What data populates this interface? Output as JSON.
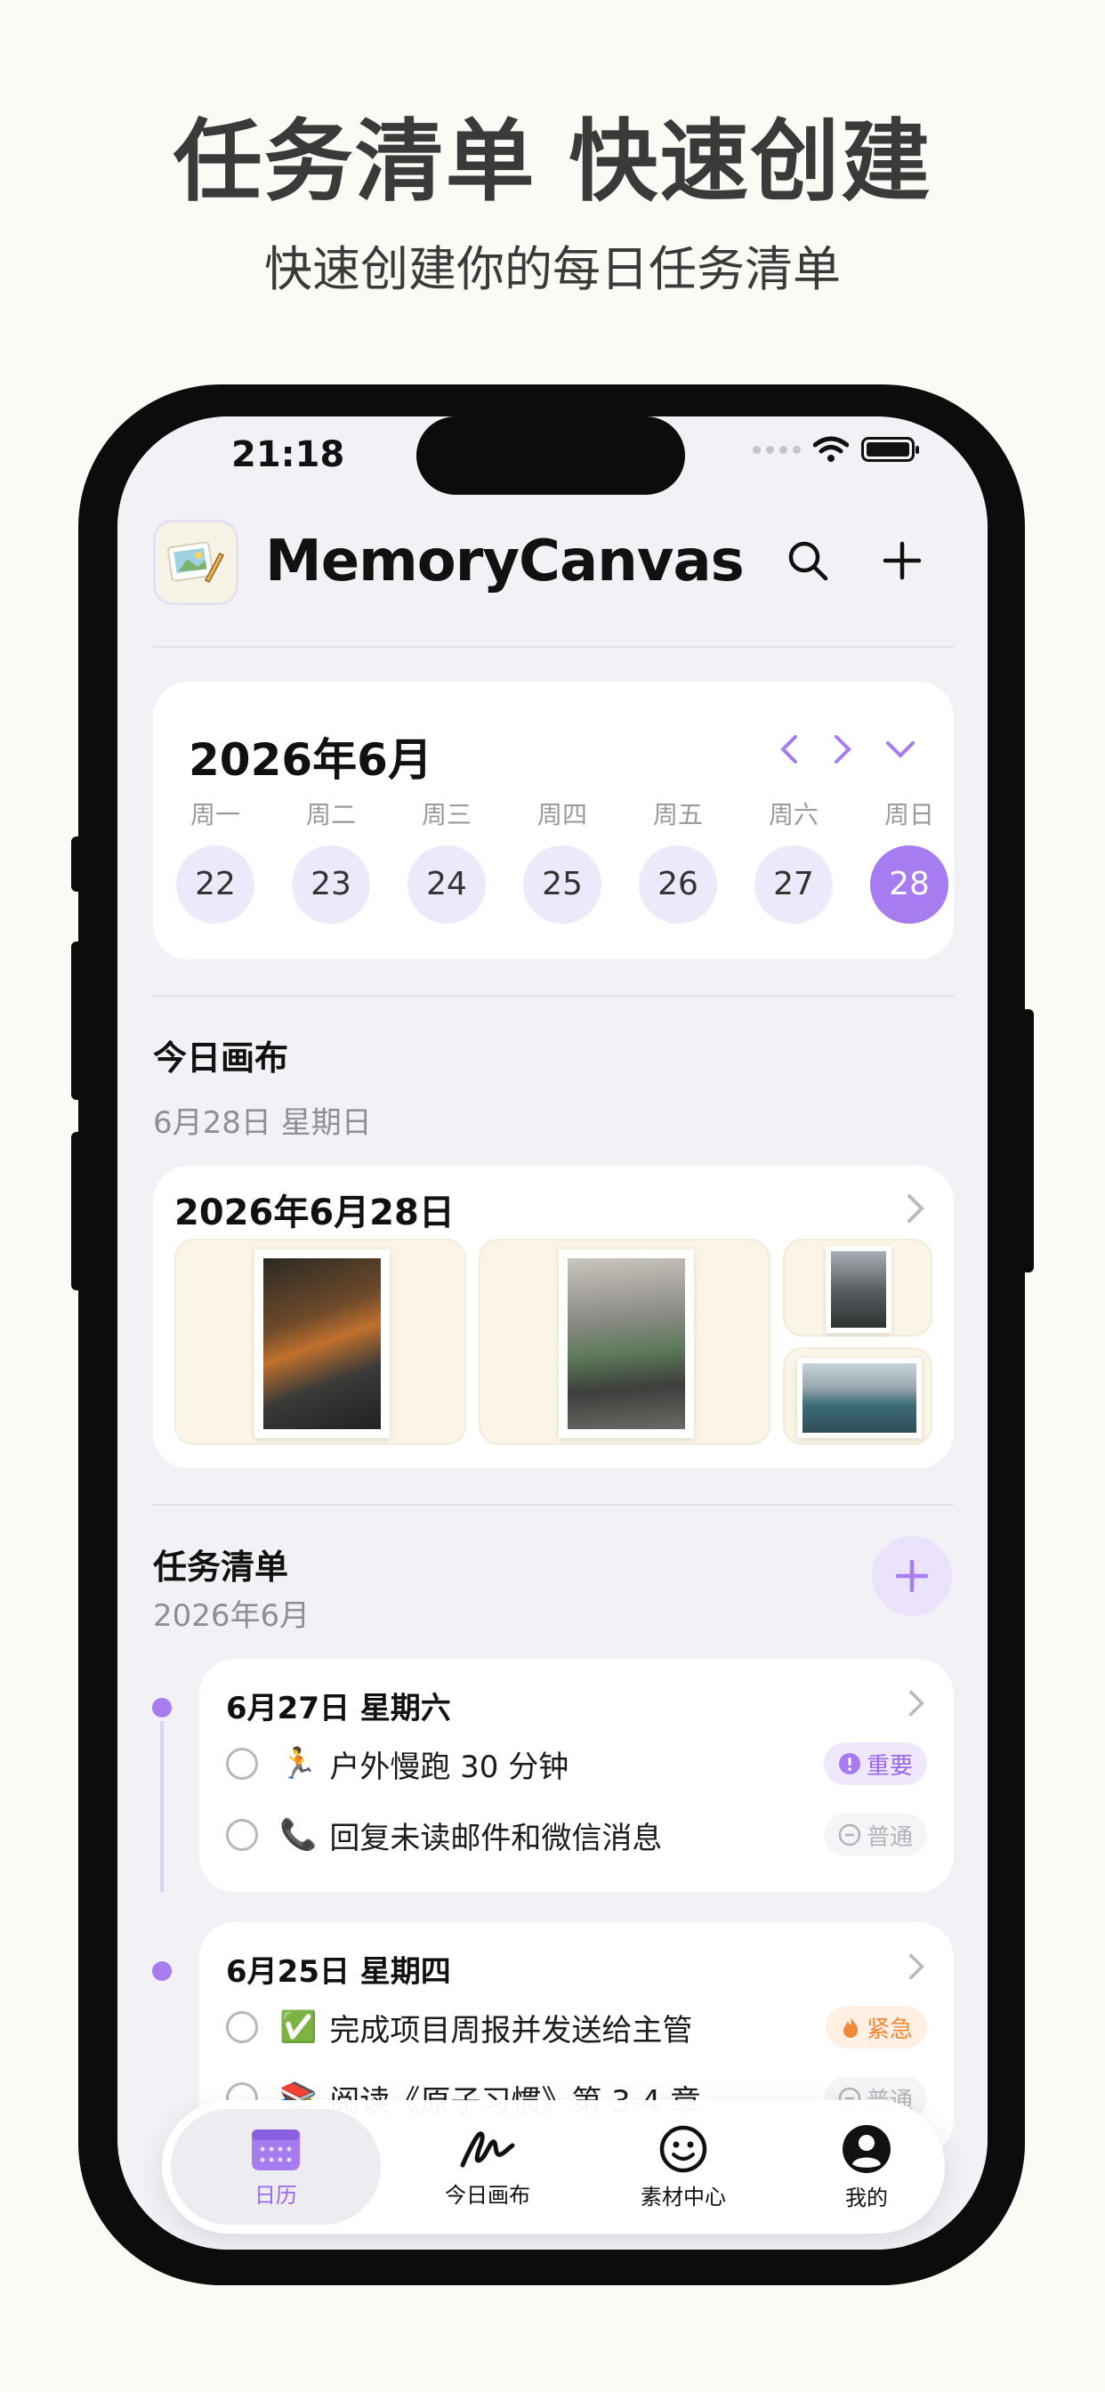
{
  "promo": {
    "title": "任务清单 快速创建",
    "subtitle": "快速创建你的每日任务清单"
  },
  "status_bar": {
    "time": "21:18"
  },
  "header": {
    "app_name": "MemoryCanvas",
    "search_icon": "search-icon",
    "add_icon": "plus-icon"
  },
  "calendar": {
    "month_label": "2026年6月",
    "days": [
      {
        "weekday": "周一",
        "date": "22"
      },
      {
        "weekday": "周二",
        "date": "23"
      },
      {
        "weekday": "周三",
        "date": "24"
      },
      {
        "weekday": "周四",
        "date": "25"
      },
      {
        "weekday": "周五",
        "date": "26"
      },
      {
        "weekday": "周六",
        "date": "27"
      },
      {
        "weekday": "周日",
        "date": "28"
      }
    ],
    "selected_date": "28",
    "accent_color": "#a67cf0"
  },
  "today_canvas": {
    "section_title": "今日画布",
    "section_date": "6月28日 星期日",
    "card_date": "2026年6月28日"
  },
  "task_list": {
    "section_title": "任务清单",
    "section_month": "2026年6月",
    "groups": [
      {
        "date_label": "6月27日 星期六",
        "tasks": [
          {
            "emoji": "🏃",
            "text": "户外慢跑 30 分钟",
            "badge": "重要",
            "badge_type": "important"
          },
          {
            "emoji": "📞",
            "text": "回复未读邮件和微信消息",
            "badge": "普通",
            "badge_type": "normal"
          }
        ]
      },
      {
        "date_label": "6月25日 星期四",
        "tasks": [
          {
            "emoji": "✅",
            "text": "完成项目周报并发送给主管",
            "badge": "紧急",
            "badge_type": "urgent"
          },
          {
            "emoji": "📚",
            "text": "阅读《原子习惯》第 3-4 章",
            "badge": "普通",
            "badge_type": "normal"
          }
        ]
      }
    ]
  },
  "tab_bar": {
    "tabs": [
      {
        "label": "日历",
        "icon": "calendar-icon",
        "active": true
      },
      {
        "label": "今日画布",
        "icon": "scribble-icon",
        "active": false
      },
      {
        "label": "素材中心",
        "icon": "smiley-icon",
        "active": false
      },
      {
        "label": "我的",
        "icon": "profile-icon",
        "active": false
      }
    ]
  }
}
